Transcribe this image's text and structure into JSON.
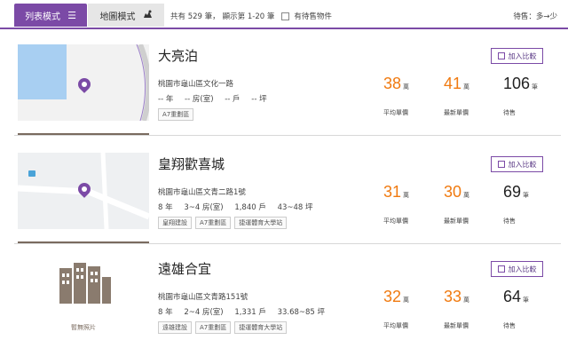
{
  "topbar": {
    "list_mode": "列表模式",
    "list_icon": "list-icon",
    "map_mode": "地圖模式",
    "map_icon": "map-icon",
    "summary_total": "共有 529 筆",
    "summary_range": "顯示第 1-20 筆",
    "summary_sep": "，",
    "unsold_label": "有待售物件",
    "sort_label": "待售：多→少"
  },
  "colors": {
    "accent": "#7b4aa6",
    "price": "#f07a10"
  },
  "listings": [
    {
      "name": "大亮泊",
      "address": "桃園市龜山區文化一路",
      "specs": [
        "-- 年",
        "-- 房(室)",
        "-- 戶",
        "-- 坪"
      ],
      "tags": [
        "A7重劃區"
      ],
      "avg_price": "38",
      "avg_unit": "萬",
      "avg_label": "平均單價",
      "latest_price": "41",
      "latest_unit": "萬",
      "latest_label": "最新單價",
      "for_sale": "106",
      "for_sale_unit": "筆",
      "for_sale_label": "待售",
      "compare_label": "加入比較"
    },
    {
      "name": "皇翔歡喜城",
      "address": "桃園市龜山區文青二路1號",
      "specs": [
        "8 年",
        "3~4 房(室)",
        "1,840 戶",
        "43~48 坪"
      ],
      "tags": [
        "皇翔建設",
        "A7重劃區",
        "捷運體育大學站"
      ],
      "avg_price": "31",
      "avg_unit": "萬",
      "avg_label": "平均單價",
      "latest_price": "30",
      "latest_unit": "萬",
      "latest_label": "最新單價",
      "for_sale": "69",
      "for_sale_unit": "筆",
      "for_sale_label": "待售",
      "compare_label": "加入比較"
    },
    {
      "name": "遠雄合宜",
      "address": "桃園市龜山區文青路151號",
      "specs": [
        "8 年",
        "2~4 房(室)",
        "1,331 戶",
        "33.68~85 坪"
      ],
      "tags": [
        "遠雄建設",
        "A7重劃區",
        "捷運體育大學站"
      ],
      "no_photo": "暫無照片",
      "avg_price": "32",
      "avg_unit": "萬",
      "avg_label": "平均單價",
      "latest_price": "33",
      "latest_unit": "萬",
      "latest_label": "最新單價",
      "for_sale": "64",
      "for_sale_unit": "筆",
      "for_sale_label": "待售",
      "compare_label": "加入比較"
    }
  ]
}
